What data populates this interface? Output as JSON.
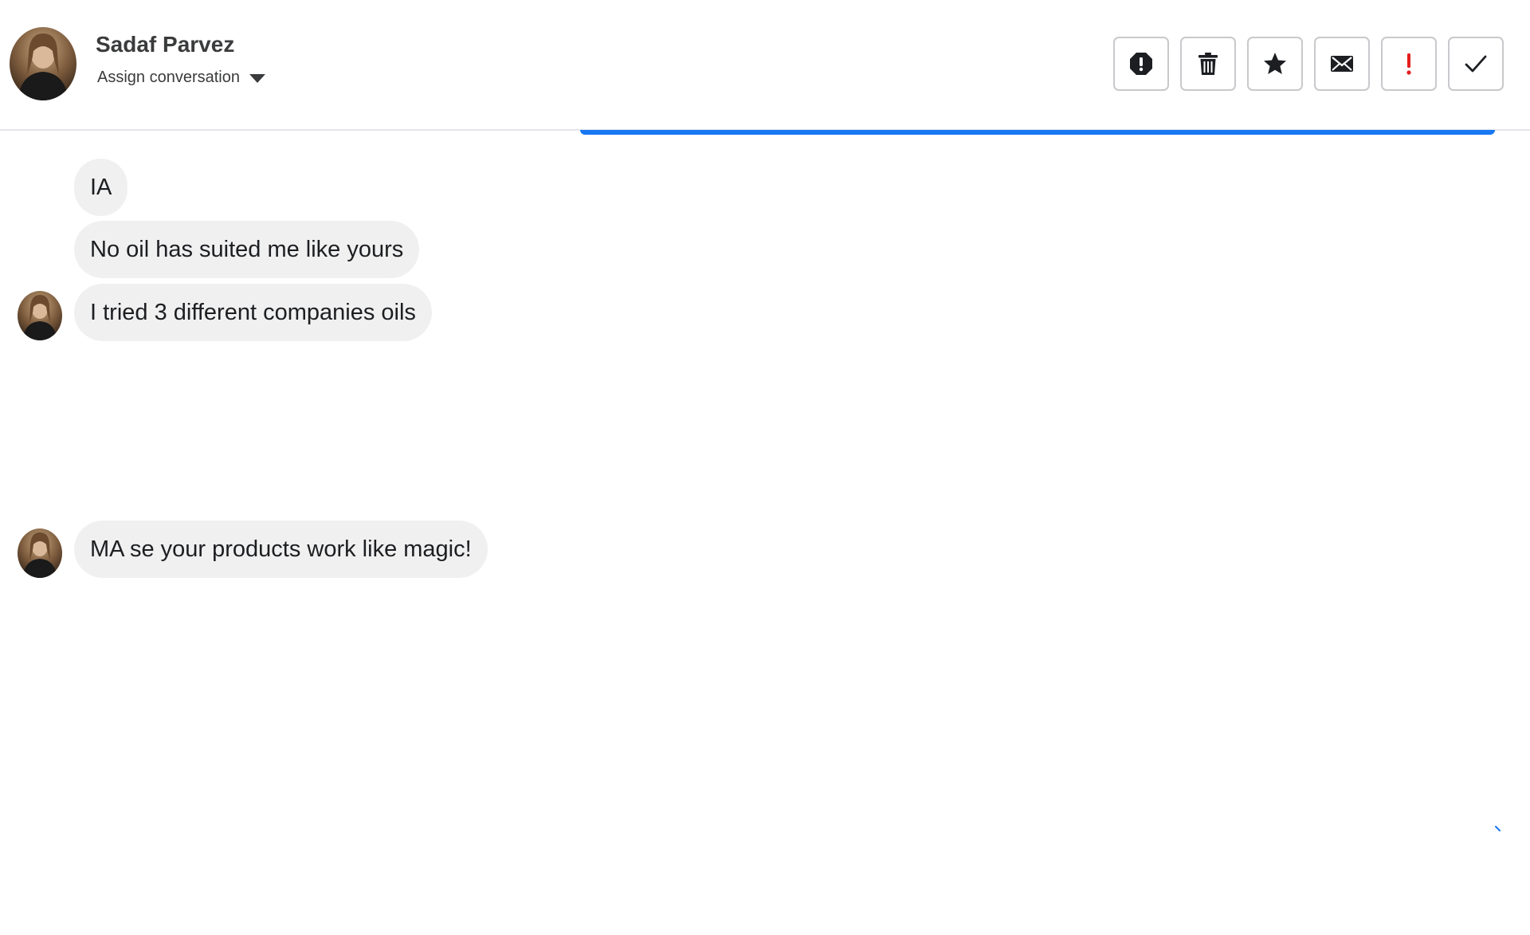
{
  "header": {
    "contact_name": "Sadaf Parvez",
    "assign_label": "Assign conversation"
  },
  "toolbar": {
    "buttons": [
      {
        "name": "report-icon",
        "color": "#1c1e21"
      },
      {
        "name": "trash-icon",
        "color": "#1c1e21"
      },
      {
        "name": "star-icon",
        "color": "#1c1e21"
      },
      {
        "name": "mail-icon",
        "color": "#1c1e21"
      },
      {
        "name": "exclamation-icon",
        "color": "#e41e1e"
      },
      {
        "name": "check-icon",
        "color": "#1c1e21"
      }
    ]
  },
  "messages": [
    {
      "text": "IA",
      "avatar": false
    },
    {
      "text": "No oil has suited me like yours",
      "avatar": false
    },
    {
      "text": "I tried 3 different companies oils",
      "avatar": true
    },
    {
      "text": "MA se your products work like magic!",
      "avatar": true
    }
  ],
  "colors": {
    "accent": "#1877f2",
    "bubble": "#f0f0f0"
  }
}
